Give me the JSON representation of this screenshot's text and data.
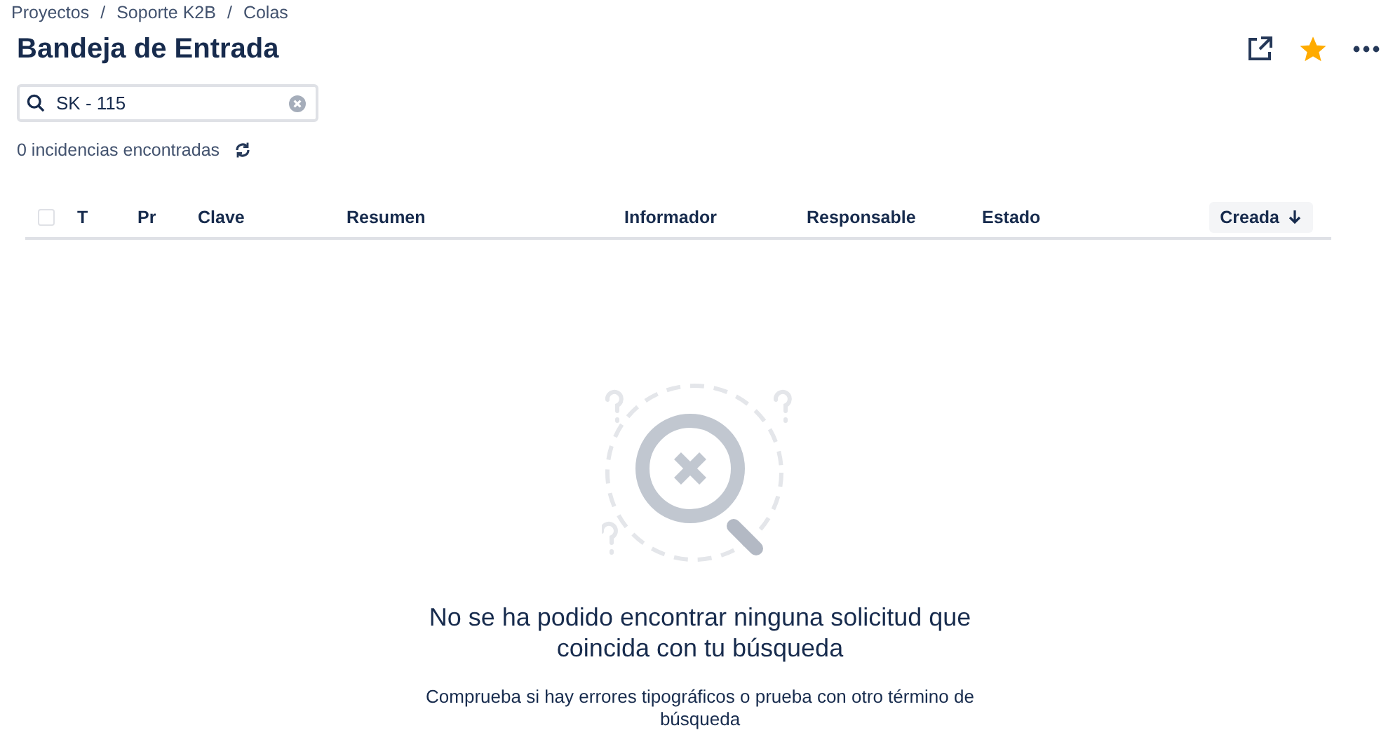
{
  "breadcrumbs": {
    "separator": "/",
    "items": [
      "Proyectos",
      "Soporte K2B",
      "Colas"
    ]
  },
  "title": "Bandeja de Entrada",
  "header_actions": {
    "starred": true
  },
  "search": {
    "value": "SK - 115"
  },
  "result_count": "0 incidencias encontradas",
  "table": {
    "select_all": {
      "checked": false
    },
    "columns": [
      {
        "label": "T",
        "sorted": false
      },
      {
        "label": "Pr",
        "sorted": false
      },
      {
        "label": "Clave",
        "sorted": false
      },
      {
        "label": "Resumen",
        "sorted": false
      },
      {
        "label": "Informador",
        "sorted": false
      },
      {
        "label": "Responsable",
        "sorted": false
      },
      {
        "label": "Estado",
        "sorted": false
      },
      {
        "label": "Creada",
        "sorted": true
      }
    ]
  },
  "empty_state": {
    "heading": "No se ha podido encontrar ninguna solicitud que coincida con tu búsqueda",
    "message": "Comprueba si hay errores tipográficos o prueba con otro término de búsqueda"
  }
}
